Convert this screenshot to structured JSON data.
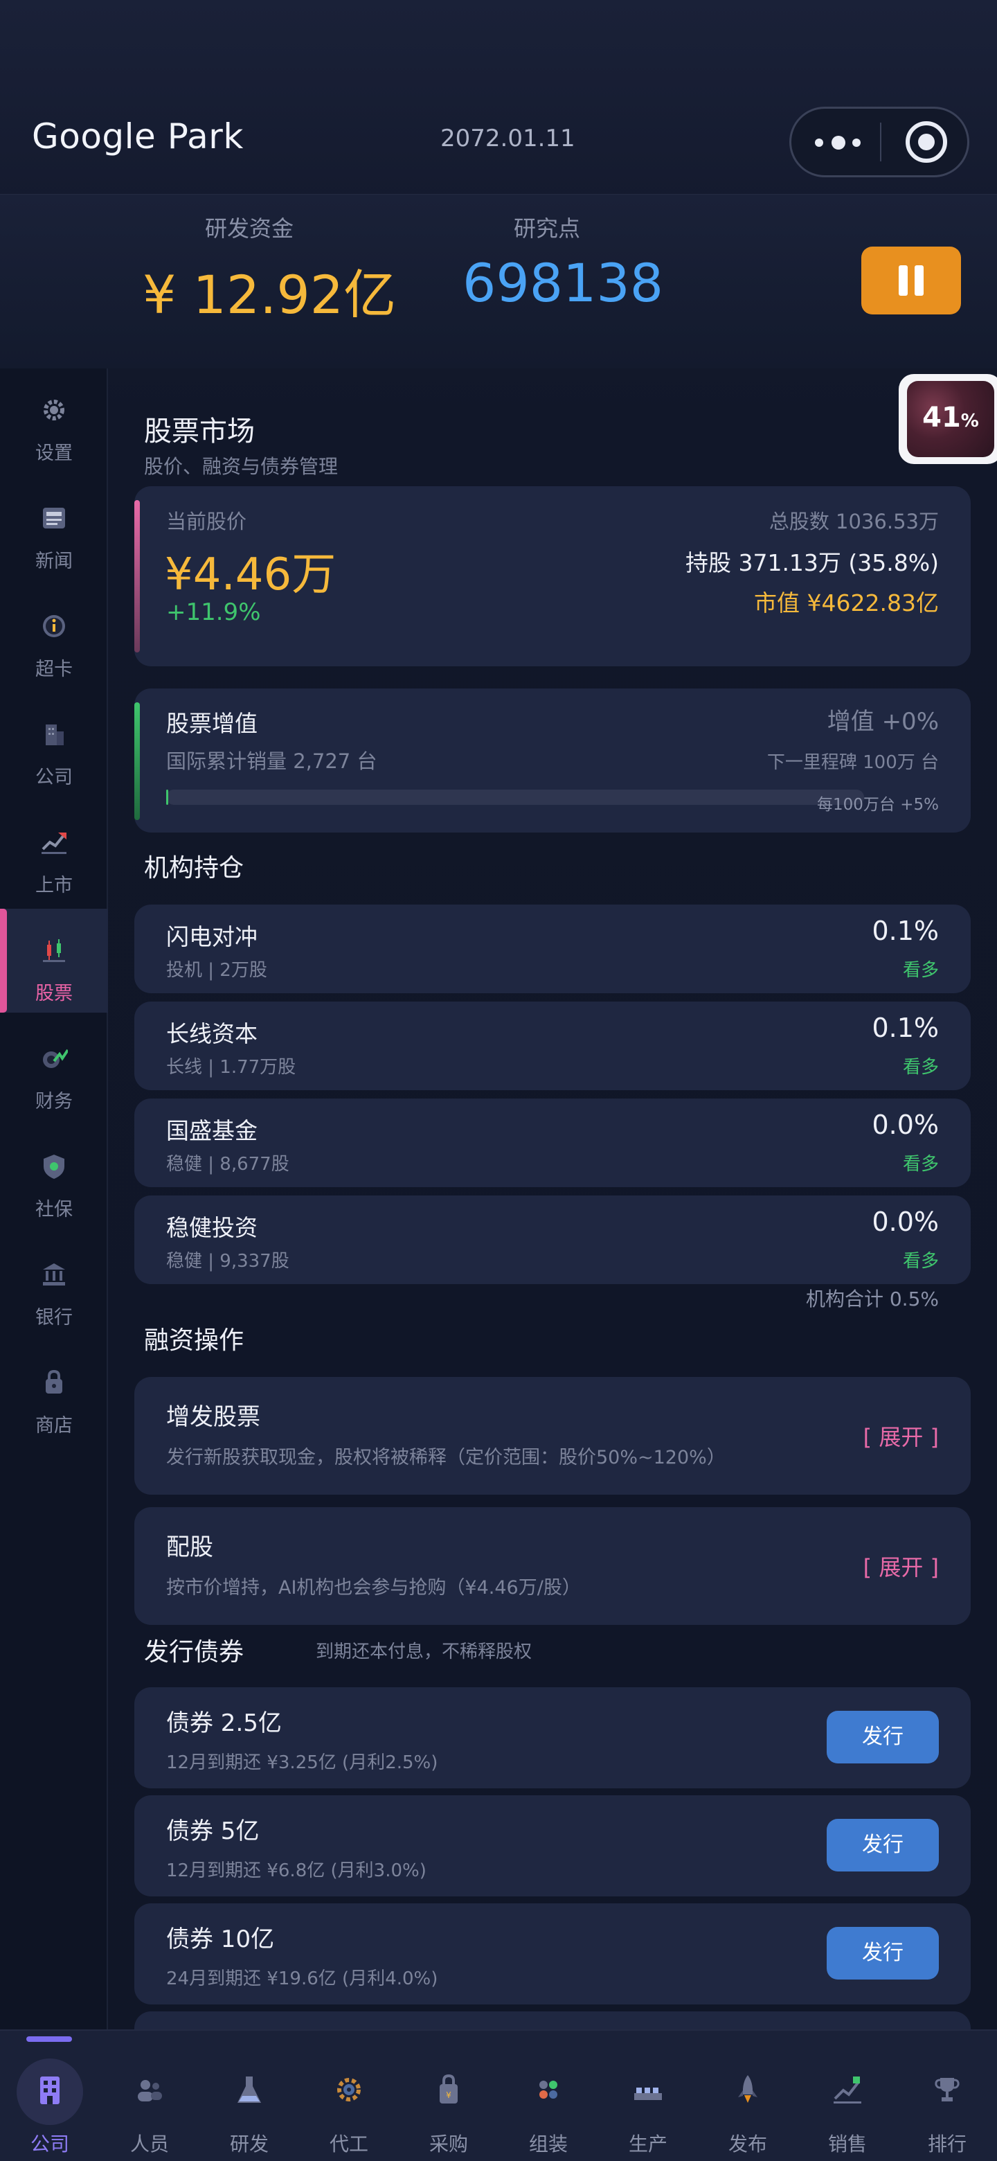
{
  "header": {
    "title": "Google Park",
    "date": "2072.01.11"
  },
  "stats": {
    "funds_label": "研发资金",
    "funds_value": "¥ 12.92亿",
    "rp_label": "研究点",
    "rp_value": "698138"
  },
  "avatar_badge": {
    "value": "41",
    "unit": "%"
  },
  "sidebar": {
    "items": [
      {
        "label": "设置",
        "icon": "gear-icon"
      },
      {
        "label": "新闻",
        "icon": "newspaper-icon"
      },
      {
        "label": "超卡",
        "icon": "info-icon"
      },
      {
        "label": "公司",
        "icon": "building-icon"
      },
      {
        "label": "上市",
        "icon": "trend-up-icon"
      },
      {
        "label": "股票",
        "icon": "candlestick-icon",
        "active": true
      },
      {
        "label": "财务",
        "icon": "finance-icon"
      },
      {
        "label": "社保",
        "icon": "shield-icon"
      },
      {
        "label": "银行",
        "icon": "bank-icon"
      },
      {
        "label": "商店",
        "icon": "lock-bag-icon"
      }
    ]
  },
  "stock": {
    "title": "股票市场",
    "subtitle": "股价、融资与债券管理",
    "price_label": "当前股价",
    "price": "¥4.46万",
    "change": "+11.9%",
    "total_shares": "总股数 1036.53万",
    "holdings": "持股 371.13万 (35.8%)",
    "market_cap": "市值 ¥4622.83亿"
  },
  "appreciation": {
    "title": "股票增值",
    "value": "增值 +0%",
    "sales": "国际累计销量 2,727 台",
    "milestone": "下一里程碑 100万 台",
    "note": "每100万台 +5%",
    "progress": 0.0027
  },
  "institutions": {
    "title": "机构持仓",
    "items": [
      {
        "name": "闪电对冲",
        "detail": "投机 | 2万股",
        "pct": "0.1%",
        "stance": "看多"
      },
      {
        "name": "长线资本",
        "detail": "长线 | 1.77万股",
        "pct": "0.1%",
        "stance": "看多"
      },
      {
        "name": "国盛基金",
        "detail": "稳健 | 8,677股",
        "pct": "0.0%",
        "stance": "看多"
      },
      {
        "name": "稳健投资",
        "detail": "稳健 | 9,337股",
        "pct": "0.0%",
        "stance": "看多"
      }
    ],
    "total": "机构合计 0.5%"
  },
  "financing": {
    "title": "融资操作",
    "items": [
      {
        "name": "增发股票",
        "desc": "发行新股获取现金，股权将被稀释（定价范围：股价50%~120%）",
        "action": "[ 展开 ]"
      },
      {
        "name": "配股",
        "desc": "按市价增持，AI机构也会参与抢购（¥4.46万/股）",
        "action": "[ 展开 ]"
      }
    ]
  },
  "bonds": {
    "title": "发行债券",
    "subtitle": "到期还本付息，不稀释股权",
    "items": [
      {
        "name": "债券 2.5亿",
        "desc": "12月到期还 ¥3.25亿 (月利2.5%)",
        "action": "发行"
      },
      {
        "name": "债券 5亿",
        "desc": "12月到期还 ¥6.8亿 (月利3.0%)",
        "action": "发行"
      },
      {
        "name": "债券 10亿",
        "desc": "24月到期还 ¥19.6亿 (月利4.0%)",
        "action": "发行"
      }
    ]
  },
  "bottom_nav": {
    "items": [
      {
        "label": "公司",
        "icon": "office-building-icon",
        "active": true
      },
      {
        "label": "人员",
        "icon": "people-icon"
      },
      {
        "label": "研发",
        "icon": "flask-icon"
      },
      {
        "label": "代工",
        "icon": "cog-icon"
      },
      {
        "label": "采购",
        "icon": "shopping-bag-icon"
      },
      {
        "label": "组装",
        "icon": "components-icon"
      },
      {
        "label": "生产",
        "icon": "factory-icon"
      },
      {
        "label": "发布",
        "icon": "rocket-icon"
      },
      {
        "label": "销售",
        "icon": "chart-up-icon"
      },
      {
        "label": "排行",
        "icon": "trophy-icon"
      }
    ]
  },
  "colors": {
    "accent_yellow": "#f6b93b",
    "accent_blue": "#4aa3f5",
    "accent_pink": "#e86aa8",
    "accent_green": "#3fc56d",
    "pause_orange": "#e8901f",
    "issue_blue": "#3f7bd0"
  }
}
